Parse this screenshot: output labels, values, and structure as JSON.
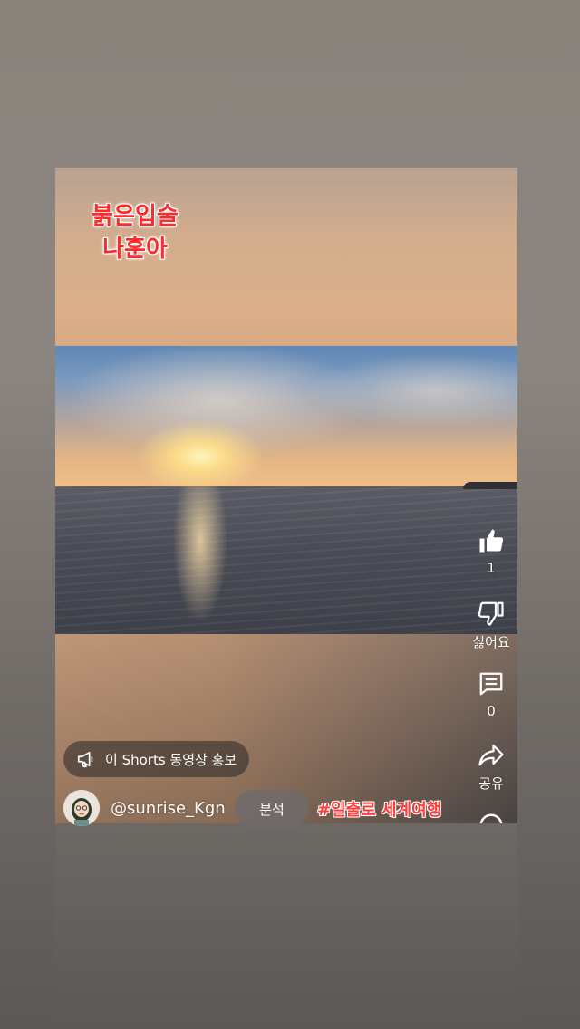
{
  "overlay": {
    "title_line1": "붉은입술",
    "title_line2": "나훈아"
  },
  "actions": {
    "like": {
      "icon": "thumbs-up-icon",
      "count": "1"
    },
    "dislike": {
      "icon": "thumbs-down-icon",
      "label": "싫어요"
    },
    "comments": {
      "icon": "comment-icon",
      "count": "0"
    },
    "share": {
      "icon": "share-icon",
      "label": "공유"
    },
    "remix": {
      "icon": "remix-icon"
    }
  },
  "promote": {
    "icon": "megaphone-icon",
    "label": "이 Shorts 동영상 홍보"
  },
  "channel": {
    "handle": "@sunrise_Kgn",
    "analysis_label": "분석",
    "hashtag": "#일출로 세계여행"
  },
  "colors": {
    "overlay_text": "#ff2b2b",
    "background": "#8a837c"
  }
}
